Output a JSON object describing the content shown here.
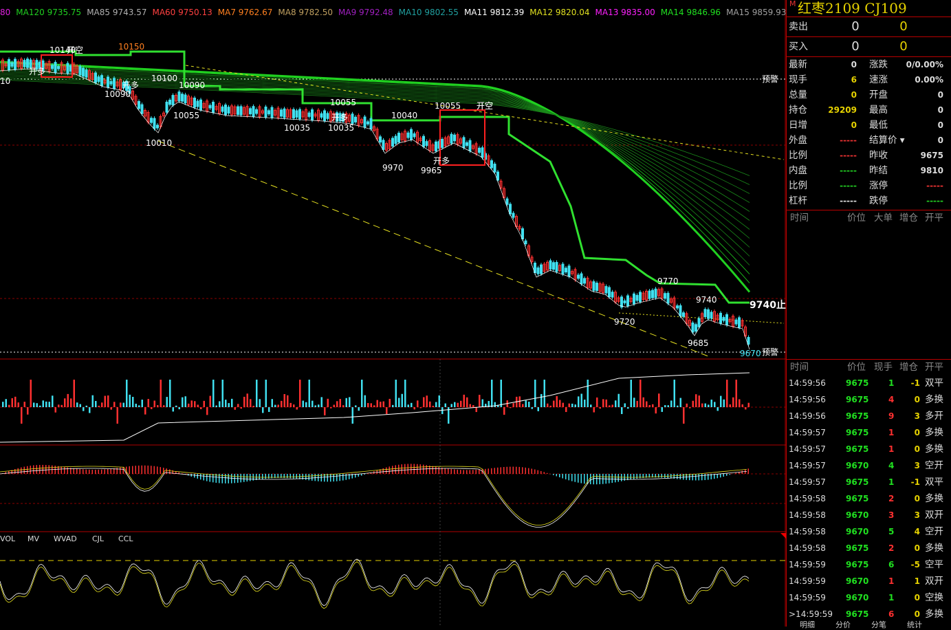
{
  "ma_legend": [
    {
      "label": "80",
      "color": "#e020e0"
    },
    {
      "label": "MA120 9735.75",
      "color": "#20d020"
    },
    {
      "label": "MA85 9743.57",
      "color": "#b0b0b0"
    },
    {
      "label": "MA60 9750.13",
      "color": "#ff4040"
    },
    {
      "label": "MA7 9762.67",
      "color": "#ff8020"
    },
    {
      "label": "MA8 9782.50",
      "color": "#c0a060"
    },
    {
      "label": "MA9 9792.48",
      "color": "#a020c0"
    },
    {
      "label": "MA10 9802.55",
      "color": "#20a0a0"
    },
    {
      "label": "MA11 9812.39",
      "color": "#ffffff"
    },
    {
      "label": "MA12 9820.04",
      "color": "#e0e020"
    },
    {
      "label": "MA13 9835.00",
      "color": "#ff20ff"
    },
    {
      "label": "MA14 9846.96",
      "color": "#20e020"
    },
    {
      "label": "MA15 9859.93",
      "color": "#a0a0a0"
    }
  ],
  "chart_labels": [
    "10140",
    "开空",
    "10150",
    "开多",
    "开多",
    "10",
    "10090",
    "10100",
    "10090",
    "10055",
    "10010",
    "10035",
    "10035",
    "10055",
    "开多",
    "开空",
    "10040",
    "9970",
    "9965",
    "开多",
    "10055",
    "开空",
    "9770",
    "9740",
    "9720",
    "9685",
    "9670"
  ],
  "stop_label": "9740止",
  "alert_label": "预警",
  "indicator_tabs": [
    "VOL",
    "MV",
    "WVAD",
    "CJL",
    "CCL"
  ],
  "side": {
    "marker": "M",
    "title": "红枣2109  CJ109",
    "sell": {
      "label": "卖出",
      "price": "0",
      "vol": "0"
    },
    "buy": {
      "label": "买入",
      "price": "0",
      "vol": "0"
    },
    "quote_rows": [
      {
        "l1": "最新",
        "v1": "0",
        "c1": "#ddd",
        "l2": "涨跌",
        "v2": "0/0.00%",
        "c2": "#ddd"
      },
      {
        "l1": "现手",
        "v1": "6",
        "c1": "#e6d200",
        "l2": "速涨",
        "v2": "0.00%",
        "c2": "#ddd"
      },
      {
        "l1": "总量",
        "v1": "0",
        "c1": "#e6d200",
        "l2": "开盘",
        "v2": "0",
        "c2": "#ddd"
      },
      {
        "l1": "持仓",
        "v1": "29209",
        "c1": "#e6d200",
        "l2": "最高",
        "v2": "0",
        "c2": "#ddd"
      },
      {
        "l1": "日增",
        "v1": "0",
        "c1": "#e6d200",
        "l2": "最低",
        "v2": "0",
        "c2": "#ddd"
      },
      {
        "l1": "外盘",
        "v1": "-----",
        "c1": "#e33",
        "l2": "结算价 ▾",
        "v2": "0",
        "c2": "#ddd"
      },
      {
        "l1": "比例",
        "v1": "-----",
        "c1": "#e33",
        "l2": "昨收",
        "v2": "9675",
        "c2": "#ddd"
      },
      {
        "l1": "内盘",
        "v1": "-----",
        "c1": "#2c2",
        "l2": "昨结",
        "v2": "9810",
        "c2": "#ddd"
      },
      {
        "l1": "比例",
        "v1": "-----",
        "c1": "#2c2",
        "l2": "涨停",
        "v2": "-----",
        "c2": "#e33"
      },
      {
        "l1": "杠杆",
        "v1": "-----",
        "c1": "#ddd",
        "l2": "跌停",
        "v2": "-----",
        "c2": "#2c2"
      }
    ],
    "header1": {
      "time": "时间",
      "price": "价位",
      "big": "大单",
      "inc": "增仓",
      "oc": "开平"
    },
    "header2": {
      "time": "时间",
      "price": "价位",
      "vol": "现手",
      "inc": "增仓",
      "oc": "开平"
    },
    "ticks": [
      {
        "time": "14:59:56",
        "price": "9675",
        "vol": "1",
        "inc": "-1",
        "oc": "双平",
        "ocColor": "#ddd"
      },
      {
        "time": "14:59:56",
        "price": "9675",
        "vol": "4",
        "inc": "0",
        "oc": "多换",
        "ocColor": "#ddd"
      },
      {
        "time": "14:59:56",
        "price": "9675",
        "vol": "9",
        "inc": "3",
        "oc": "多开",
        "ocColor": "#ddd"
      },
      {
        "time": "14:59:57",
        "price": "9675",
        "vol": "1",
        "inc": "0",
        "oc": "多换",
        "ocColor": "#ddd"
      },
      {
        "time": "14:59:57",
        "price": "9675",
        "vol": "1",
        "inc": "0",
        "oc": "多换",
        "ocColor": "#ddd"
      },
      {
        "time": "14:59:57",
        "price": "9670",
        "vol": "4",
        "inc": "3",
        "oc": "空开",
        "ocColor": "#ddd"
      },
      {
        "time": "14:59:57",
        "price": "9675",
        "vol": "1",
        "inc": "-1",
        "oc": "双平",
        "ocColor": "#ddd"
      },
      {
        "time": "14:59:58",
        "price": "9675",
        "vol": "2",
        "inc": "0",
        "oc": "多换",
        "ocColor": "#ddd"
      },
      {
        "time": "14:59:58",
        "price": "9670",
        "vol": "3",
        "inc": "3",
        "oc": "双开",
        "ocColor": "#ddd"
      },
      {
        "time": "14:59:58",
        "price": "9670",
        "vol": "5",
        "inc": "4",
        "oc": "空开",
        "ocColor": "#ddd"
      },
      {
        "time": "14:59:58",
        "price": "9675",
        "vol": "2",
        "inc": "0",
        "oc": "多换",
        "ocColor": "#ddd"
      },
      {
        "time": "14:59:59",
        "price": "9675",
        "vol": "6",
        "inc": "-5",
        "oc": "空平",
        "ocColor": "#ddd"
      },
      {
        "time": "14:59:59",
        "price": "9670",
        "vol": "1",
        "inc": "1",
        "oc": "双开",
        "ocColor": "#ddd"
      },
      {
        "time": "14:59:59",
        "price": "9670",
        "vol": "1",
        "inc": "0",
        "oc": "空换",
        "ocColor": "#ddd"
      },
      {
        "time": "14:59:59",
        "price": "9675",
        "vol": "6",
        "inc": "0",
        "oc": "多换",
        "ocColor": "#ddd"
      }
    ],
    "bottom_tabs": [
      "明细",
      "分价",
      "分笔",
      "统计"
    ]
  },
  "colors": {
    "up": "#ff3030",
    "down": "#40e0f0",
    "ma_green": "#20d020",
    "grid": "#8b0000",
    "border": "#b00000"
  }
}
